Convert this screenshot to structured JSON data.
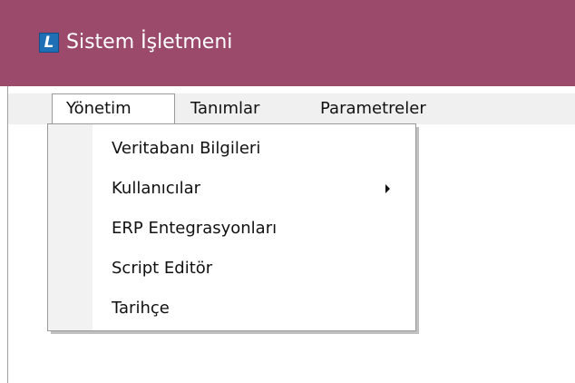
{
  "window": {
    "title": "Sistem İşletmeni",
    "logo_letter": "L",
    "titlebar_color": "#9b4a6c",
    "logo_color": "#1f6fb6"
  },
  "menubar": {
    "items": [
      {
        "label": "Yönetim",
        "open": true
      },
      {
        "label": "Tanımlar",
        "open": false
      },
      {
        "label": "Parametreler",
        "open": false
      }
    ]
  },
  "dropdown": {
    "parent": "Yönetim",
    "items": [
      {
        "label": "Veritabanı Bilgileri",
        "has_submenu": false
      },
      {
        "label": "Kullanıcılar",
        "has_submenu": true,
        "submenu_icon": "chevron-right-icon"
      },
      {
        "label": "ERP Entegrasyonları",
        "has_submenu": false
      },
      {
        "label": "Script Editör",
        "has_submenu": false
      },
      {
        "label": "Tarihçe",
        "has_submenu": false
      }
    ]
  }
}
